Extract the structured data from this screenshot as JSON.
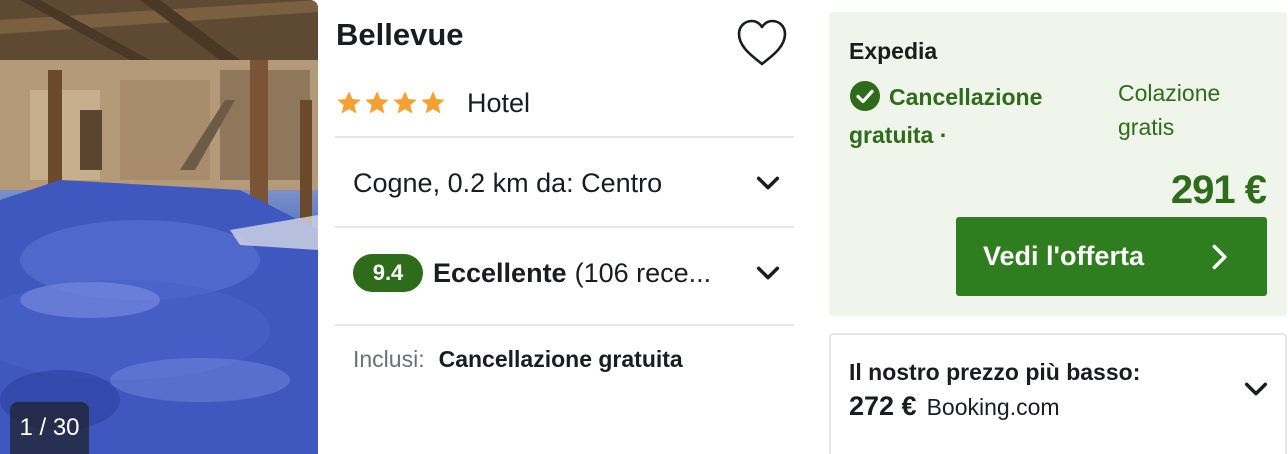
{
  "photo": {
    "counter": "1 / 30"
  },
  "hotel": {
    "name": "Bellevue",
    "stars": 4,
    "type": "Hotel",
    "location": "Cogne, 0.2 km da: Centro",
    "score": "9.4",
    "rating_word": "Eccellente",
    "rating_count": "(106 rece...",
    "included_label": "Inclusi:",
    "included_value": "Cancellazione gratuita"
  },
  "offer": {
    "provider": "Expedia",
    "cancellation": "Cancellazione gratuita",
    "separator": "·",
    "breakfast": "Colazione gratis",
    "price": "291 €",
    "cta_label": "Vedi l'offerta"
  },
  "lowest": {
    "title": "Il nostro prezzo più basso:",
    "price": "272 €",
    "site": "Booking.com"
  },
  "colors": {
    "green": "#2e6b1a",
    "cta_green": "#2e7d1e",
    "star": "#f5a033",
    "panel_bg": "#eff5ea"
  },
  "icons": [
    "heart-icon",
    "star-icon",
    "chevron-down-icon",
    "check-circle-icon",
    "chevron-right-icon"
  ]
}
